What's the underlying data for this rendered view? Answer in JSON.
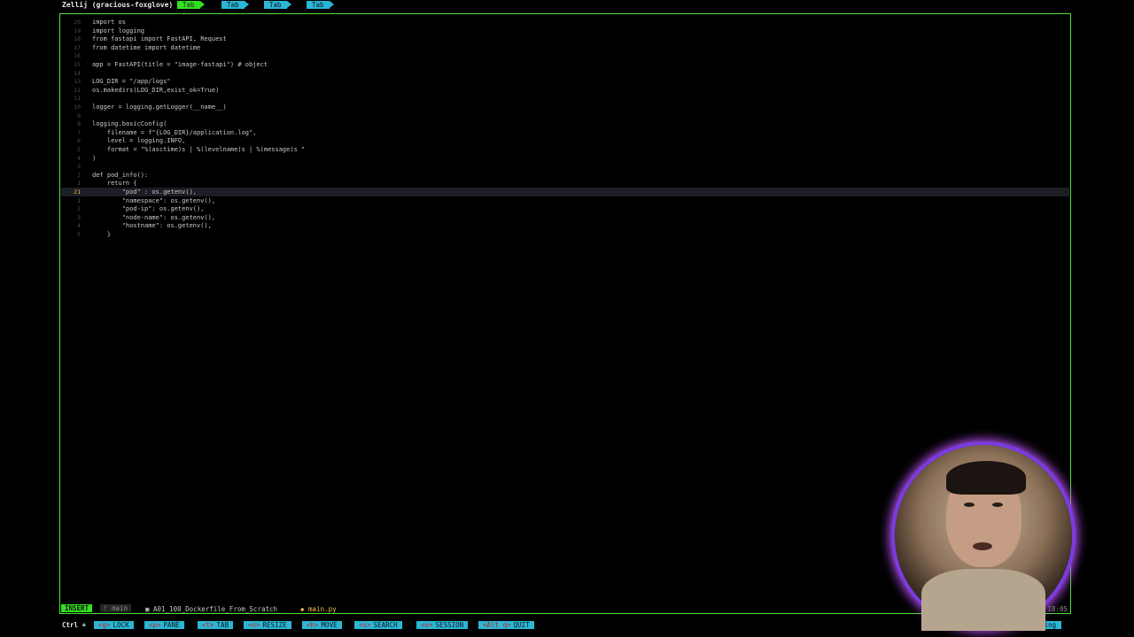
{
  "session": {
    "title": "Zellij (gracious-foxglove)"
  },
  "tabs": [
    {
      "label": "Tab #1",
      "active": true
    },
    {
      "label": "Tab #2",
      "active": false
    },
    {
      "label": "Tab #3",
      "active": false
    },
    {
      "label": "Tab #4",
      "active": false
    }
  ],
  "editor": {
    "cursor_line_number": "21",
    "lines": [
      {
        "ln": "20",
        "code": "import os"
      },
      {
        "ln": "19",
        "code": "import logging"
      },
      {
        "ln": "18",
        "code": "from fastapi import FastAPI, Request"
      },
      {
        "ln": "17",
        "code": "from datetime import datetime"
      },
      {
        "ln": "16",
        "code": ""
      },
      {
        "ln": "15",
        "code": "app = FastAPI(title = \"image-fastapi\") # object"
      },
      {
        "ln": "14",
        "code": ""
      },
      {
        "ln": "13",
        "code": "LOG_DIR = \"/app/logs\""
      },
      {
        "ln": "12",
        "code": "os.makedirs(LOG_DIR,exist_ok=True)"
      },
      {
        "ln": "11",
        "code": ""
      },
      {
        "ln": "10",
        "code": "logger = logging.getLogger(__name__)"
      },
      {
        "ln": "9",
        "code": ""
      },
      {
        "ln": "8",
        "code": "logging.basicConfig("
      },
      {
        "ln": "7",
        "code": "    filename = f\"{LOG_DIR}/application.log\","
      },
      {
        "ln": "6",
        "code": "    level = logging.INFO,"
      },
      {
        "ln": "5",
        "code": "    format = \"%(asctime)s | %(levelname)s | %(message)s \""
      },
      {
        "ln": "4",
        "code": ")"
      },
      {
        "ln": "3",
        "code": ""
      },
      {
        "ln": "2",
        "code": "def pod_info():"
      },
      {
        "ln": "1",
        "code": "    return {"
      },
      {
        "ln": "21",
        "code": "        \"pod\" : os.getenv(),",
        "current": true
      },
      {
        "ln": "1",
        "code": "        \"namespace\": os.getenv(),"
      },
      {
        "ln": "2",
        "code": "        \"pod-ip\": os.getenv(),"
      },
      {
        "ln": "3",
        "code": "        \"node-name\": os.getenv(),"
      },
      {
        "ln": "4",
        "code": "        \"hostname\": os.getenv(),"
      },
      {
        "ln": "5",
        "code": "    }"
      }
    ]
  },
  "statusline": {
    "mode": "INSERT",
    "branch": "main",
    "path": "A01_100_Dockerfile_From_Scratch",
    "file": "main.py",
    "time": "18:05"
  },
  "keybar": {
    "ctrl_label": "Ctrl +",
    "keys": [
      {
        "key": "<g>",
        "label": "LOCK"
      },
      {
        "key": "<p>",
        "label": "PANE"
      },
      {
        "key": "<t>",
        "label": "TAB"
      },
      {
        "key": "<n>",
        "label": "RESIZE"
      },
      {
        "key": "<h>",
        "label": "MOVE"
      },
      {
        "key": "<s>",
        "label": "SEARCH"
      },
      {
        "key": "<o>",
        "label": "SESSION"
      },
      {
        "key": "<Alt q>",
        "label": "QUIT"
      }
    ],
    "floating_label": "Floating"
  },
  "colors": {
    "accent": "#32e01f",
    "tab": "#2ab7d6",
    "pane_border": "#4fe03a",
    "cursor_line_number": "#f2c14e"
  }
}
